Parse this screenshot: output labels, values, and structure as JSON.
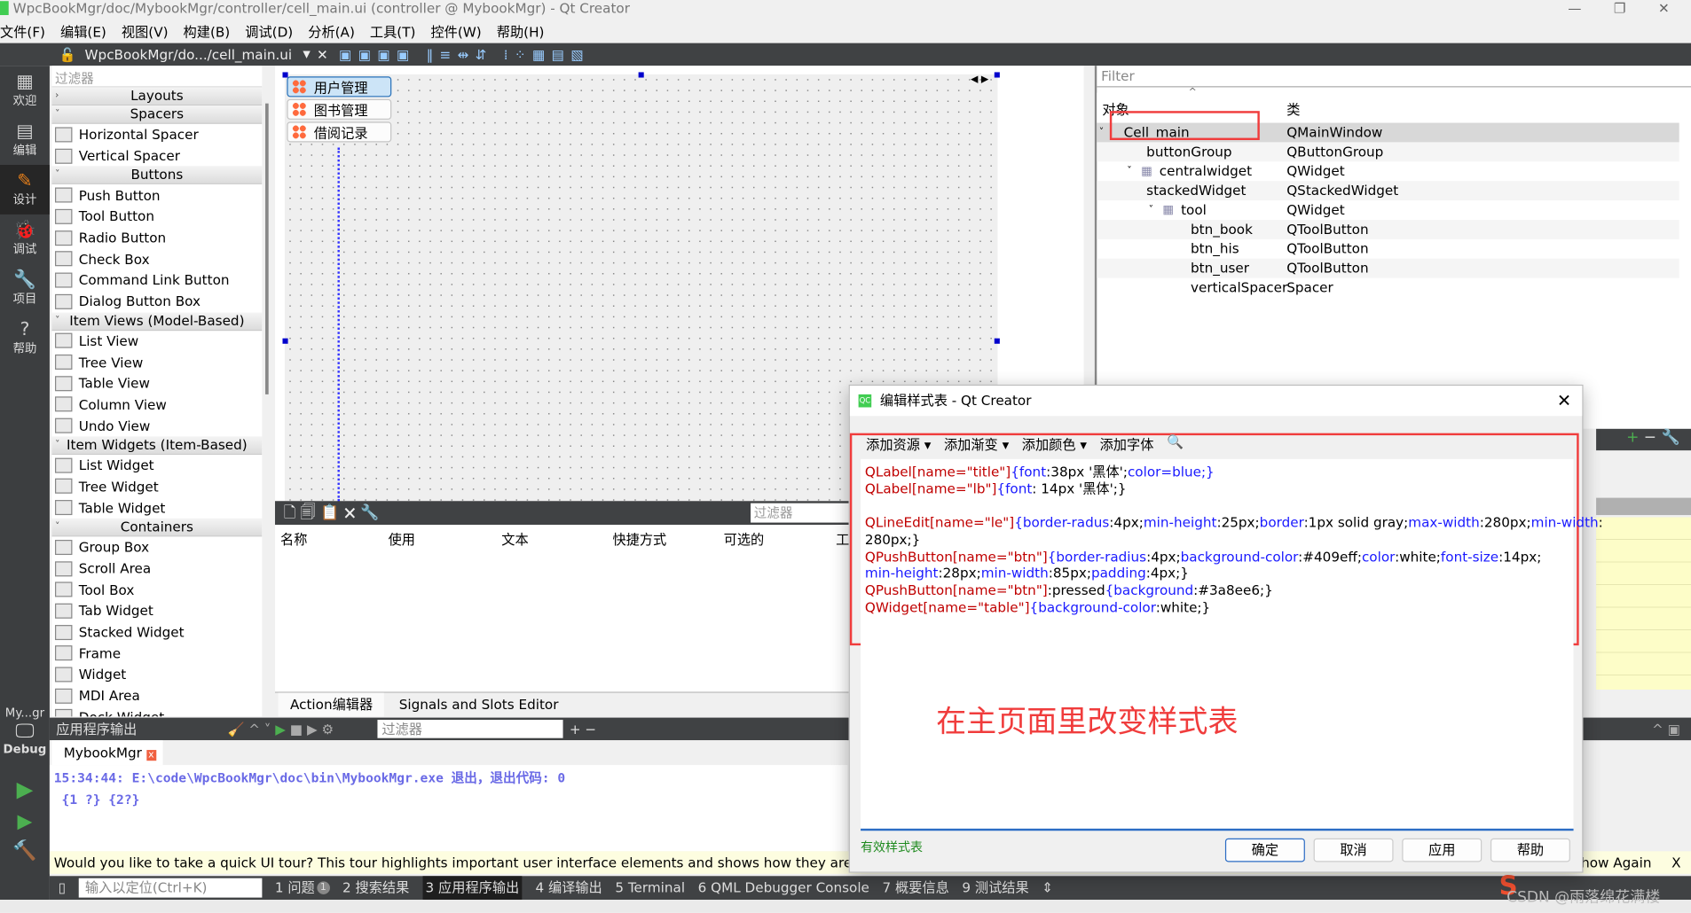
{
  "window": {
    "title": "WpcBookMgr/doc/MybookMgr/controller/cell_main.ui (controller @ MybookMgr) - Qt Creator",
    "controls": [
      "—",
      "❐",
      "✕"
    ]
  },
  "menu": [
    "文件(F)",
    "编辑(E)",
    "视图(V)",
    "构建(B)",
    "调试(D)",
    "分析(A)",
    "工具(T)",
    "控件(W)",
    "帮助(H)"
  ],
  "toolbar": {
    "file": "WpcBookMgr/do.../cell_main.ui"
  },
  "modes": [
    {
      "label": "欢迎",
      "icon": "grid-icon"
    },
    {
      "label": "编辑",
      "icon": "document-icon"
    },
    {
      "label": "设计",
      "icon": "pencil-icon"
    },
    {
      "label": "调试",
      "icon": "bug-icon"
    },
    {
      "label": "项目",
      "icon": "wrench-icon"
    },
    {
      "label": "帮助",
      "icon": "help-icon"
    }
  ],
  "kit": {
    "project": "My...gr",
    "config": "Debug"
  },
  "widget_box": {
    "filter_placeholder": "过滤器",
    "sections": [
      {
        "title": "Layouts",
        "collapsed": true,
        "items": []
      },
      {
        "title": "Spacers",
        "items": [
          "Horizontal Spacer",
          "Vertical Spacer"
        ]
      },
      {
        "title": "Buttons",
        "items": [
          "Push Button",
          "Tool Button",
          "Radio Button",
          "Check Box",
          "Command Link Button",
          "Dialog Button Box"
        ]
      },
      {
        "title": "Item Views (Model-Based)",
        "items": [
          "List View",
          "Tree View",
          "Table View",
          "Column View",
          "Undo View"
        ]
      },
      {
        "title": "Item Widgets (Item-Based)",
        "items": [
          "List Widget",
          "Tree Widget",
          "Table Widget"
        ]
      },
      {
        "title": "Containers",
        "items": [
          "Group Box",
          "Scroll Area",
          "Tool Box",
          "Tab Widget",
          "Stacked Widget",
          "Frame",
          "Widget",
          "MDI Area",
          "Dock Widget"
        ]
      }
    ]
  },
  "form": {
    "buttons": [
      "用户管理",
      "图书管理",
      "借阅记录"
    ]
  },
  "action_editor": {
    "filter_placeholder": "过滤器",
    "columns": [
      "名称",
      "使用",
      "文本",
      "快捷方式",
      "可选的",
      "工"
    ],
    "tabs": [
      "Action编辑器",
      "Signals and Slots Editor"
    ]
  },
  "object_inspector": {
    "filter_placeholder": "Filter",
    "columns": [
      "对象",
      "类"
    ],
    "rows": [
      {
        "name": "Cell_main",
        "class": "QMainWindow",
        "depth": 0,
        "expanded": true,
        "selected": true
      },
      {
        "name": "buttonGroup",
        "class": "QButtonGroup",
        "depth": 1
      },
      {
        "name": "centralwidget",
        "class": "QWidget",
        "depth": 1,
        "expanded": true,
        "icon": true
      },
      {
        "name": "stackedWidget",
        "class": "QStackedWidget",
        "depth": 2
      },
      {
        "name": "tool",
        "class": "QWidget",
        "depth": 2,
        "expanded": true,
        "icon": true
      },
      {
        "name": "btn_book",
        "class": "QToolButton",
        "depth": 3
      },
      {
        "name": "btn_his",
        "class": "QToolButton",
        "depth": 3
      },
      {
        "name": "btn_user",
        "class": "QToolButton",
        "depth": 3
      },
      {
        "name": "verticalSpacer",
        "class": "Spacer",
        "depth": 3
      }
    ]
  },
  "output": {
    "title": "应用程序输出",
    "filter_placeholder": "过滤器",
    "tab": "MybookMgr",
    "lines": [
      "15:34:44: E:\\code\\WpcBookMgr\\doc\\bin\\MybookMgr.exe 退出，退出代码: 0",
      " {1 ?} {2?}"
    ]
  },
  "tour": {
    "text": "Would you like to take a quick UI tour? This tour highlights important user interface elements and shows how they are used.",
    "dismiss": "how Again",
    "close": "X"
  },
  "statusbar": {
    "locator_placeholder": "输入以定位(Ctrl+K)",
    "tabs": [
      "1 问题",
      "2 搜索结果",
      "3 应用程序输出",
      "4 编译输出",
      "5 Terminal",
      "6 QML Debugger Console",
      "7 概要信息",
      "9 测试结果"
    ],
    "issues_badge": "1"
  },
  "dialog": {
    "title": "编辑样式表 - Qt Creator",
    "tools": [
      "添加资源 ▾",
      "添加渐变 ▾",
      "添加颜色 ▾",
      "添加字体"
    ],
    "code": [
      [
        [
          "s",
          "QLabel[name=\"title\"]"
        ],
        [
          "p",
          "{font"
        ],
        [
          "v",
          ":38px '黑体';"
        ],
        [
          "p",
          "color=blue;}"
        ]
      ],
      [
        [
          "s",
          "QLabel[name=\"lb\"]"
        ],
        [
          "p",
          "{font"
        ],
        [
          "v",
          ": 14px '黑体';}"
        ]
      ],
      [],
      [
        [
          "s",
          "QLineEdit[name=\"le\"]"
        ],
        [
          "p",
          "{border-radus"
        ],
        [
          "v",
          ":4px;"
        ],
        [
          "p",
          "min-height"
        ],
        [
          "v",
          ":25px;"
        ],
        [
          "p",
          "border"
        ],
        [
          "v",
          ":1px solid gray;"
        ],
        [
          "p",
          "max-width"
        ],
        [
          "v",
          ":280px;"
        ],
        [
          "p",
          "min-width"
        ],
        [
          "v",
          ":"
        ]
      ],
      [
        [
          "v",
          "280px;}"
        ]
      ],
      [
        [
          "s",
          "QPushButton[name=\"btn\"]"
        ],
        [
          "p",
          "{border-radius"
        ],
        [
          "v",
          ":4px;"
        ],
        [
          "p",
          "background-color"
        ],
        [
          "v",
          ":#409eff;"
        ],
        [
          "p",
          "color"
        ],
        [
          "v",
          ":white;"
        ],
        [
          "p",
          "font-size"
        ],
        [
          "v",
          ":14px;"
        ]
      ],
      [
        [
          "p",
          "min-height"
        ],
        [
          "v",
          ":28px;"
        ],
        [
          "p",
          "min-width"
        ],
        [
          "v",
          ":85px;"
        ],
        [
          "p",
          "padding"
        ],
        [
          "v",
          ":4px;}"
        ]
      ],
      [
        [
          "s",
          "QPushButton[name=\"btn\"]"
        ],
        [
          "v",
          ":pressed"
        ],
        [
          "p",
          "{background"
        ],
        [
          "v",
          ":#3a8ee6;}"
        ]
      ],
      [
        [
          "s",
          "QWidget[name=\"table\"]"
        ],
        [
          "p",
          "{background-color"
        ],
        [
          "v",
          ":white;}"
        ]
      ]
    ],
    "annotation": "在主页面里改变样式表",
    "valid": "有效样式表",
    "buttons": [
      "确定",
      "取消",
      "应用",
      "帮助"
    ]
  },
  "watermark": "CSDN @雨落绵花满楼",
  "colors": {
    "accent_red": "#f03c3c",
    "dark": "#404244",
    "selector": "#c00000",
    "property": "#1a1aff"
  }
}
